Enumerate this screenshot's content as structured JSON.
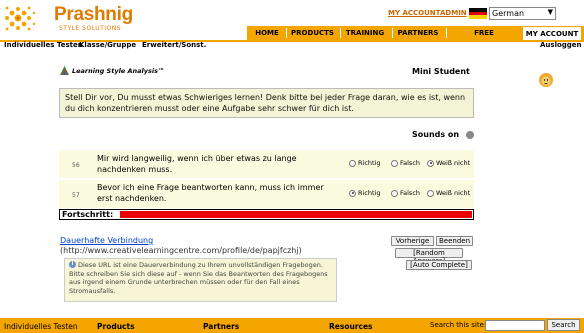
{
  "header": {
    "brand": "Prashnig",
    "brand_sub": "STYLE SOLUTIONS",
    "my_account_link": "MY ACCOUNT",
    "admin_link": "ADMIN",
    "language": "German",
    "tabs": [
      "HOME",
      "PRODUCTS",
      "TRAINING",
      "PARTNERS",
      "FREE RESOURCES",
      "MY ACCOUNT"
    ]
  },
  "subnav": {
    "items": [
      "Individuelles Testen",
      "Klasse/Gruppe",
      "Erweitert/Sonst."
    ],
    "logout": "Ausloggen"
  },
  "main": {
    "lsa_logo_text": "Learning Style Analysis™",
    "user_name": "Mini Student",
    "instructions": "Stell Dir vor, Du musst etwas Schwieriges lernen! Denk bitte bei jeder Frage daran, wie es ist, wenn du dich konzentrieren musst oder eine Aufgabe sehr schwer für dich ist.",
    "sounds_label": "Sounds on",
    "options": [
      "Richtig",
      "Falsch",
      "Weiß nicht"
    ],
    "questions": [
      {
        "number": "56",
        "text": "Mir wird langweilig, wenn ich über etwas zu lange nachdenken muss.",
        "selected": "Weiß nicht"
      },
      {
        "number": "57",
        "text": "Bevor ich eine Frage beantworten kann, muss ich immer erst nachdenken.",
        "selected": "Richtig"
      }
    ],
    "progress_label": "Fortschritt:",
    "progress_fraction": 1.0,
    "permanent_link_text": "Dauerhafte Verbindung",
    "permanent_link_url": "(http://www.creativelearningcentre.com/profile/de/papjfczhj)",
    "info_text": "Diese URL ist eine Dauerverbindung zu Ihrem unvollständigen Fragebogen. Bitte schreiben Sie sich diese auf - wenn Sie das Beantworten des Fragebogens aus irgend einem Grunde unterbrechen müssen oder für den Fall eines Stromausfalls.",
    "buttons": {
      "previous": "Vorherige",
      "finish": "Beenden",
      "random": "[Random Answers]",
      "auto": "[Auto Complete]"
    }
  },
  "footer": {
    "items": [
      "Individuelles Testen",
      "Products",
      "Partners",
      "Resources"
    ],
    "search_label": "Search this site:",
    "search_value": "",
    "search_button": "Search"
  },
  "colors": {
    "accent": "#f4a500",
    "brand": "#e07b00",
    "progress": "#ee0000",
    "box": "#f3f3d6"
  }
}
